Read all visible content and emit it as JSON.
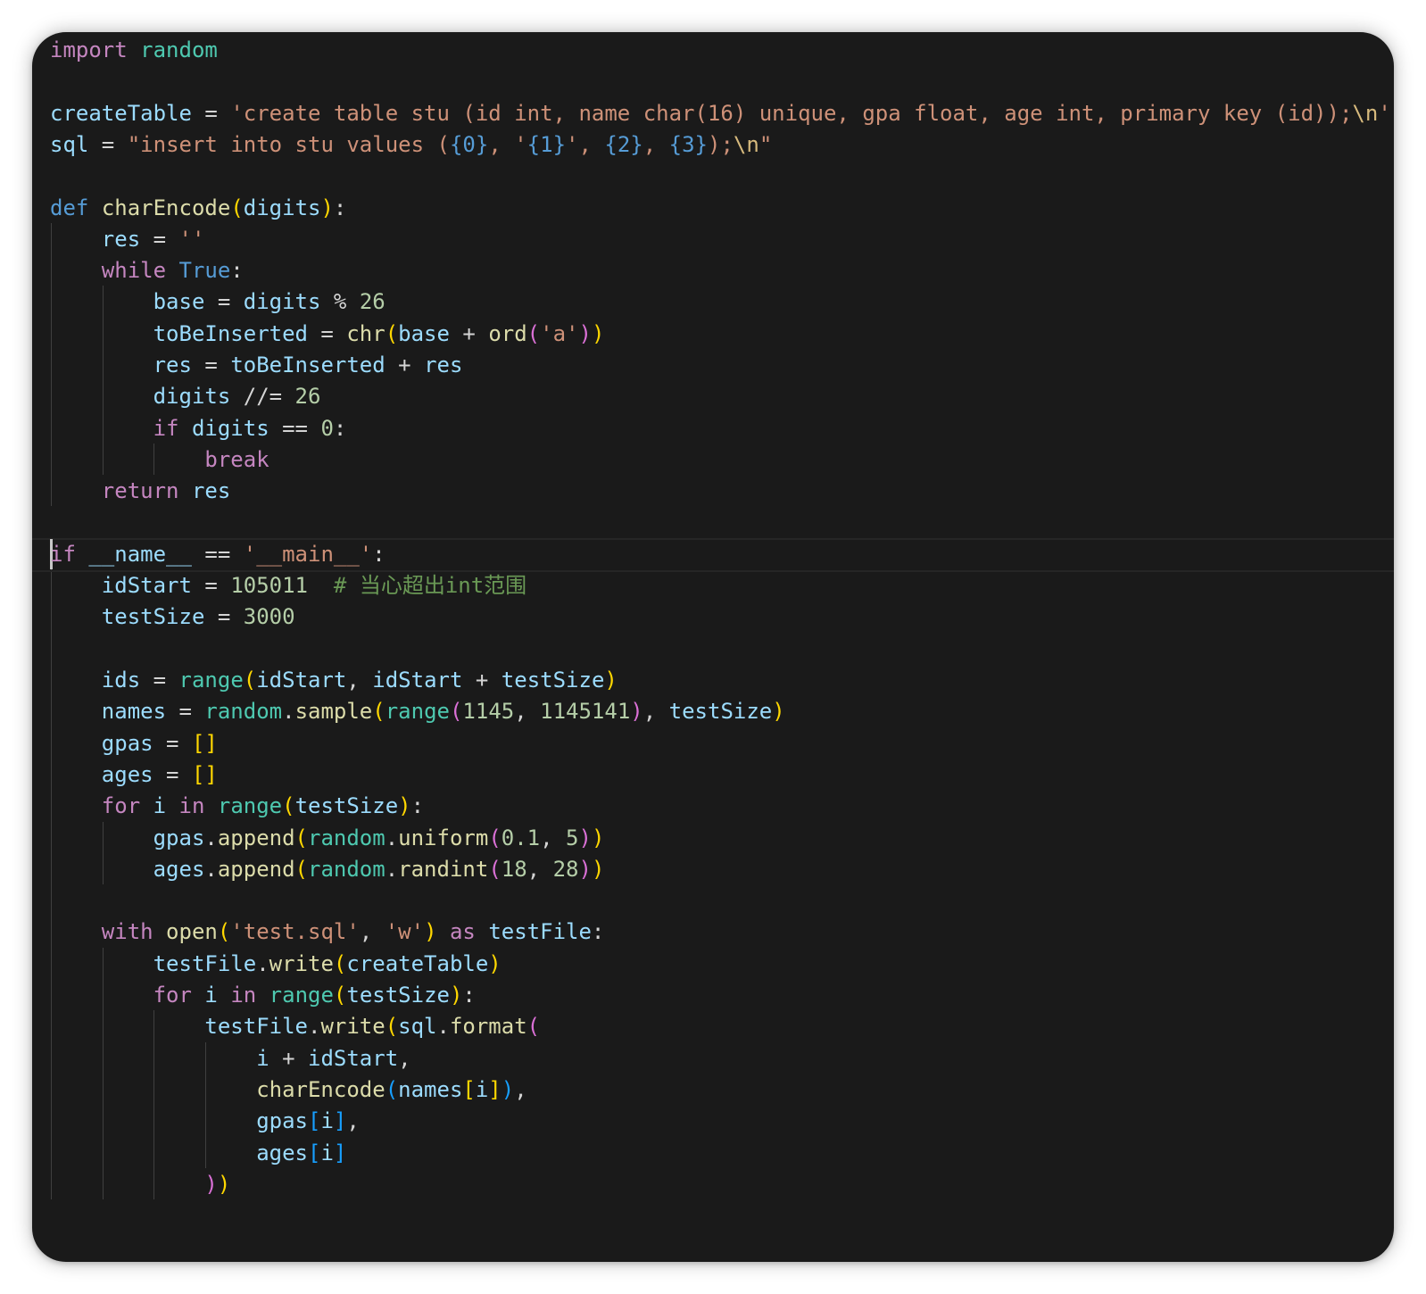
{
  "editor": {
    "language": "python",
    "cursor_line": 16,
    "lines": [
      [
        [
          "import",
          "k"
        ],
        [
          " ",
          "p"
        ],
        [
          "random",
          "m"
        ]
      ],
      [],
      [
        [
          "createTable",
          "v"
        ],
        [
          " = ",
          "p"
        ],
        [
          "'create table stu (id int, name char(16) unique, gpa float, age int, primary key (id));",
          "s"
        ],
        [
          "\\n",
          "e"
        ],
        [
          "'",
          "s"
        ]
      ],
      [
        [
          "sql",
          "v"
        ],
        [
          " = ",
          "p"
        ],
        [
          "\"insert into stu values (",
          "s"
        ],
        [
          "{0}",
          "ph"
        ],
        [
          "s",
          ""
        ],
        [
          ", '",
          "s"
        ],
        [
          "{1}",
          "ph"
        ],
        [
          "', ",
          "s"
        ],
        [
          "{2}",
          "ph"
        ],
        [
          ", ",
          "s"
        ],
        [
          "{3}",
          "ph"
        ],
        [
          ");",
          "s"
        ],
        [
          "\\n",
          "e"
        ],
        [
          "\"",
          "s"
        ]
      ],
      [],
      [
        [
          "def",
          "kb"
        ],
        [
          " ",
          "p"
        ],
        [
          "charEncode",
          "f"
        ],
        [
          "(",
          "b1"
        ],
        [
          "digits",
          "v"
        ],
        [
          ")",
          "b1"
        ],
        [
          ":",
          "p"
        ]
      ],
      [
        [
          "    ",
          "p"
        ],
        [
          "res",
          "v"
        ],
        [
          " = ",
          "p"
        ],
        [
          "''",
          "s"
        ]
      ],
      [
        [
          "    ",
          "p"
        ],
        [
          "while",
          "k"
        ],
        [
          " ",
          "p"
        ],
        [
          "True",
          "kb"
        ],
        [
          ":",
          "p"
        ]
      ],
      [
        [
          "        ",
          "p"
        ],
        [
          "base",
          "v"
        ],
        [
          " = ",
          "p"
        ],
        [
          "digits",
          "v"
        ],
        [
          " % ",
          "p"
        ],
        [
          "26",
          "n"
        ]
      ],
      [
        [
          "        ",
          "p"
        ],
        [
          "toBeInserted",
          "v"
        ],
        [
          " = ",
          "p"
        ],
        [
          "chr",
          "f"
        ],
        [
          "(",
          "b1"
        ],
        [
          "base",
          "v"
        ],
        [
          " + ",
          "p"
        ],
        [
          "ord",
          "f"
        ],
        [
          "(",
          "b2"
        ],
        [
          "'a'",
          "s"
        ],
        [
          ")",
          "b2"
        ],
        [
          ")",
          "b1"
        ]
      ],
      [
        [
          "        ",
          "p"
        ],
        [
          "res",
          "v"
        ],
        [
          " = ",
          "p"
        ],
        [
          "toBeInserted",
          "v"
        ],
        [
          " + ",
          "p"
        ],
        [
          "res",
          "v"
        ]
      ],
      [
        [
          "        ",
          "p"
        ],
        [
          "digits",
          "v"
        ],
        [
          " //= ",
          "p"
        ],
        [
          "26",
          "n"
        ]
      ],
      [
        [
          "        ",
          "p"
        ],
        [
          "if",
          "k"
        ],
        [
          " ",
          "p"
        ],
        [
          "digits",
          "v"
        ],
        [
          " == ",
          "p"
        ],
        [
          "0",
          "n"
        ],
        [
          ":",
          "p"
        ]
      ],
      [
        [
          "            ",
          "p"
        ],
        [
          "break",
          "k"
        ]
      ],
      [
        [
          "    ",
          "p"
        ],
        [
          "return",
          "k"
        ],
        [
          " ",
          "p"
        ],
        [
          "res",
          "v"
        ]
      ],
      [],
      [
        [
          "if",
          "k"
        ],
        [
          " ",
          "p"
        ],
        [
          "__name__",
          "v"
        ],
        [
          " == ",
          "p"
        ],
        [
          "'__main__'",
          "s"
        ],
        [
          ":",
          "p"
        ]
      ],
      [
        [
          "    ",
          "p"
        ],
        [
          "idStart",
          "v"
        ],
        [
          " = ",
          "p"
        ],
        [
          "105011",
          "n"
        ],
        [
          "  ",
          "p"
        ],
        [
          "# 当心超出int范围",
          "c"
        ]
      ],
      [
        [
          "    ",
          "p"
        ],
        [
          "testSize",
          "v"
        ],
        [
          " = ",
          "p"
        ],
        [
          "3000",
          "n"
        ]
      ],
      [],
      [
        [
          "    ",
          "p"
        ],
        [
          "ids",
          "v"
        ],
        [
          " = ",
          "p"
        ],
        [
          "range",
          "m"
        ],
        [
          "(",
          "b1"
        ],
        [
          "idStart",
          "v"
        ],
        [
          ", ",
          "p"
        ],
        [
          "idStart",
          "v"
        ],
        [
          " + ",
          "p"
        ],
        [
          "testSize",
          "v"
        ],
        [
          ")",
          "b1"
        ]
      ],
      [
        [
          "    ",
          "p"
        ],
        [
          "names",
          "v"
        ],
        [
          " = ",
          "p"
        ],
        [
          "random",
          "m"
        ],
        [
          ".",
          "p"
        ],
        [
          "sample",
          "f"
        ],
        [
          "(",
          "b1"
        ],
        [
          "range",
          "m"
        ],
        [
          "(",
          "b2"
        ],
        [
          "1145",
          "n"
        ],
        [
          ", ",
          "p"
        ],
        [
          "1145141",
          "n"
        ],
        [
          ")",
          "b2"
        ],
        [
          ", ",
          "p"
        ],
        [
          "testSize",
          "v"
        ],
        [
          ")",
          "b1"
        ]
      ],
      [
        [
          "    ",
          "p"
        ],
        [
          "gpas",
          "v"
        ],
        [
          " = ",
          "p"
        ],
        [
          "[]",
          "b1"
        ]
      ],
      [
        [
          "    ",
          "p"
        ],
        [
          "ages",
          "v"
        ],
        [
          " = ",
          "p"
        ],
        [
          "[]",
          "b1"
        ]
      ],
      [
        [
          "    ",
          "p"
        ],
        [
          "for",
          "k"
        ],
        [
          " ",
          "p"
        ],
        [
          "i",
          "v"
        ],
        [
          " ",
          "p"
        ],
        [
          "in",
          "k"
        ],
        [
          " ",
          "p"
        ],
        [
          "range",
          "m"
        ],
        [
          "(",
          "b1"
        ],
        [
          "testSize",
          "v"
        ],
        [
          ")",
          "b1"
        ],
        [
          ":",
          "p"
        ]
      ],
      [
        [
          "        ",
          "p"
        ],
        [
          "gpas",
          "v"
        ],
        [
          ".",
          "p"
        ],
        [
          "append",
          "f"
        ],
        [
          "(",
          "b1"
        ],
        [
          "random",
          "m"
        ],
        [
          ".",
          "p"
        ],
        [
          "uniform",
          "f"
        ],
        [
          "(",
          "b2"
        ],
        [
          "0.1",
          "n"
        ],
        [
          ", ",
          "p"
        ],
        [
          "5",
          "n"
        ],
        [
          ")",
          "b2"
        ],
        [
          ")",
          "b1"
        ]
      ],
      [
        [
          "        ",
          "p"
        ],
        [
          "ages",
          "v"
        ],
        [
          ".",
          "p"
        ],
        [
          "append",
          "f"
        ],
        [
          "(",
          "b1"
        ],
        [
          "random",
          "m"
        ],
        [
          ".",
          "p"
        ],
        [
          "randint",
          "f"
        ],
        [
          "(",
          "b2"
        ],
        [
          "18",
          "n"
        ],
        [
          ", ",
          "p"
        ],
        [
          "28",
          "n"
        ],
        [
          ")",
          "b2"
        ],
        [
          ")",
          "b1"
        ]
      ],
      [],
      [
        [
          "    ",
          "p"
        ],
        [
          "with",
          "k"
        ],
        [
          " ",
          "p"
        ],
        [
          "open",
          "f"
        ],
        [
          "(",
          "b1"
        ],
        [
          "'test.sql'",
          "s"
        ],
        [
          ", ",
          "p"
        ],
        [
          "'w'",
          "s"
        ],
        [
          ")",
          "b1"
        ],
        [
          " ",
          "p"
        ],
        [
          "as",
          "k"
        ],
        [
          " ",
          "p"
        ],
        [
          "testFile",
          "v"
        ],
        [
          ":",
          "p"
        ]
      ],
      [
        [
          "        ",
          "p"
        ],
        [
          "testFile",
          "v"
        ],
        [
          ".",
          "p"
        ],
        [
          "write",
          "f"
        ],
        [
          "(",
          "b1"
        ],
        [
          "createTable",
          "v"
        ],
        [
          ")",
          "b1"
        ]
      ],
      [
        [
          "        ",
          "p"
        ],
        [
          "for",
          "k"
        ],
        [
          " ",
          "p"
        ],
        [
          "i",
          "v"
        ],
        [
          " ",
          "p"
        ],
        [
          "in",
          "k"
        ],
        [
          " ",
          "p"
        ],
        [
          "range",
          "m"
        ],
        [
          "(",
          "b1"
        ],
        [
          "testSize",
          "v"
        ],
        [
          ")",
          "b1"
        ],
        [
          ":",
          "p"
        ]
      ],
      [
        [
          "            ",
          "p"
        ],
        [
          "testFile",
          "v"
        ],
        [
          ".",
          "p"
        ],
        [
          "write",
          "f"
        ],
        [
          "(",
          "b1"
        ],
        [
          "sql",
          "v"
        ],
        [
          ".",
          "p"
        ],
        [
          "format",
          "f"
        ],
        [
          "(",
          "b2"
        ]
      ],
      [
        [
          "                ",
          "p"
        ],
        [
          "i",
          "v"
        ],
        [
          " + ",
          "p"
        ],
        [
          "idStart",
          "v"
        ],
        [
          ",",
          "p"
        ]
      ],
      [
        [
          "                ",
          "p"
        ],
        [
          "charEncode",
          "f"
        ],
        [
          "(",
          "b3"
        ],
        [
          "names",
          "v"
        ],
        [
          "[",
          "b1"
        ],
        [
          "i",
          "v"
        ],
        [
          "]",
          "b1"
        ],
        [
          ")",
          "b3"
        ],
        [
          ",",
          "p"
        ]
      ],
      [
        [
          "                ",
          "p"
        ],
        [
          "gpas",
          "v"
        ],
        [
          "[",
          "b3"
        ],
        [
          "i",
          "v"
        ],
        [
          "]",
          "b3"
        ],
        [
          ",",
          "p"
        ]
      ],
      [
        [
          "                ",
          "p"
        ],
        [
          "ages",
          "v"
        ],
        [
          "[",
          "b3"
        ],
        [
          "i",
          "v"
        ],
        [
          "]",
          "b3"
        ]
      ],
      [
        [
          "            ",
          "p"
        ],
        [
          ")",
          "b2"
        ],
        [
          ")",
          "b1"
        ]
      ]
    ]
  }
}
